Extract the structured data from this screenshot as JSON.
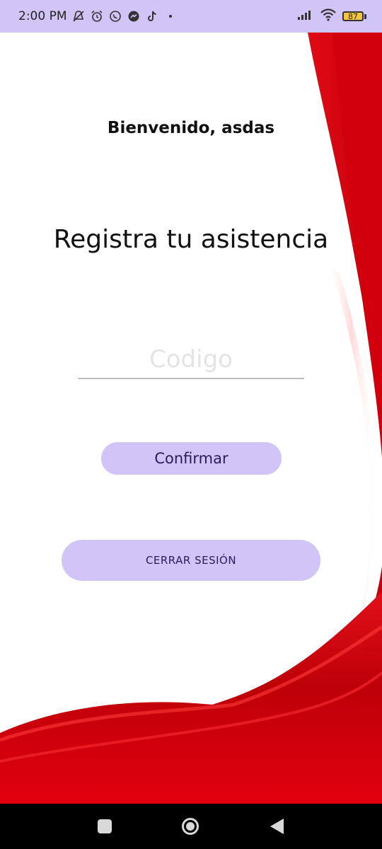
{
  "status_bar": {
    "time": "2:00 PM",
    "battery_level": "87",
    "left_icons": [
      "notifications-off-icon",
      "alarm-icon",
      "whatsapp-icon",
      "messenger-icon",
      "tiktok-icon",
      "dot-icon"
    ],
    "right_icons": [
      "signal-icon",
      "wifi-icon",
      "battery-icon"
    ],
    "background": "#d1c4f7"
  },
  "screen": {
    "welcome_text": "Bienvenido, asdas",
    "heading": "Registra tu asistencia",
    "code_input": {
      "placeholder": "Codigo",
      "value": ""
    },
    "confirm_label": "Confirmar",
    "logout_label": "CERRAR SESIÓN"
  },
  "theme": {
    "accent": "#d1c4f7",
    "button_text": "#2d1a5c",
    "decoration_red": "#d90a12",
    "decoration_dark_red": "#a4000a"
  },
  "nav_bar": {
    "buttons": [
      "recents-icon",
      "home-icon",
      "back-icon"
    ]
  }
}
